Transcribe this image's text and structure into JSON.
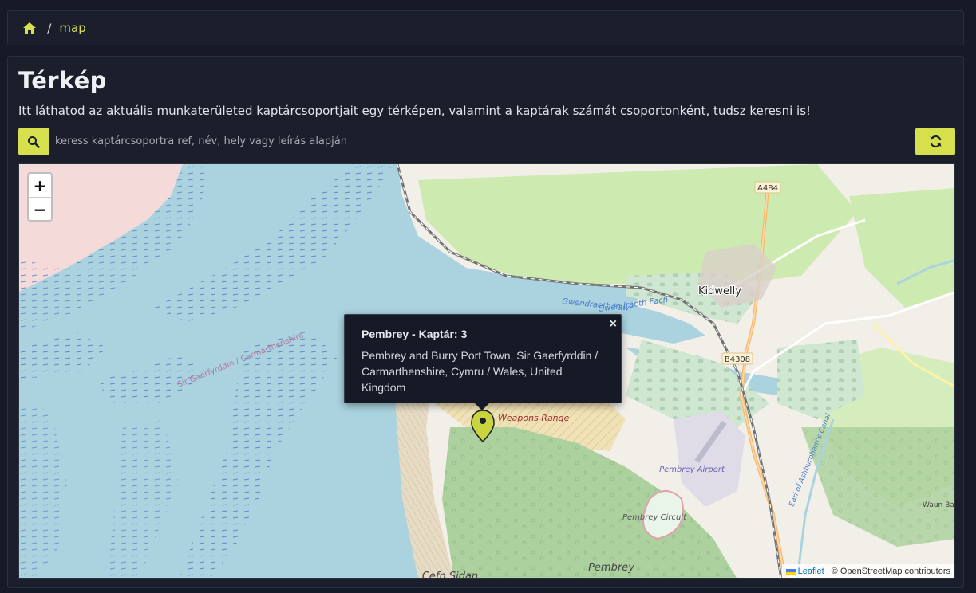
{
  "breadcrumb": {
    "separator": "/",
    "current": "map"
  },
  "page": {
    "title": "Térkép",
    "description": "Itt láthatod az aktuális munkaterületed kaptárcsoportjait egy térképen, valamint a kaptárak számát csoportonként, tudsz keresni is!"
  },
  "search": {
    "placeholder": "keress kaptárcsoportra ref, név, hely vagy leírás alapján",
    "value": ""
  },
  "map": {
    "zoom_in": "+",
    "zoom_out": "−",
    "labels": {
      "kidwelly": "Kidwelly",
      "a484": "A484",
      "b4308": "B4308",
      "gwendraeth_fawr": "Gwendraeth Fawr",
      "gwendraeth_fach": "Gwendraeth Fach",
      "sir_gaerfyrddin": "Sir Gaerfyrddin / Carmarthenshire",
      "weapons_range": "Weapons Range",
      "pembrey_airport": "Pembrey Airport",
      "pembrey_circuit": "Pembrey Circuit",
      "pembrey": "Pembrey",
      "cefn_sidan": "Cefn Sidan",
      "canal": "Earl of Ashburnham's Canal",
      "waun_baglam": "Waun Bag Wood"
    },
    "popup": {
      "title": "Pembrey - Kaptár: 3",
      "address": "Pembrey and Burry Port Town, Sir Gaerfyrddin / Carmarthenshire, Cymru / Wales, United Kingdom",
      "close": "×"
    },
    "attribution": {
      "leaflet": "Leaflet",
      "osm": "© OpenStreetMap contributors"
    }
  },
  "colors": {
    "accent": "#d6df4c",
    "page_bg": "#161a26",
    "card_bg": "#1b1f2c",
    "sea": "#aad3df",
    "forest": "#add19e",
    "land": "#f2efe9"
  },
  "icons": [
    "home-icon",
    "search-icon",
    "refresh-icon",
    "map-marker-icon",
    "ukraine-flag-icon"
  ]
}
